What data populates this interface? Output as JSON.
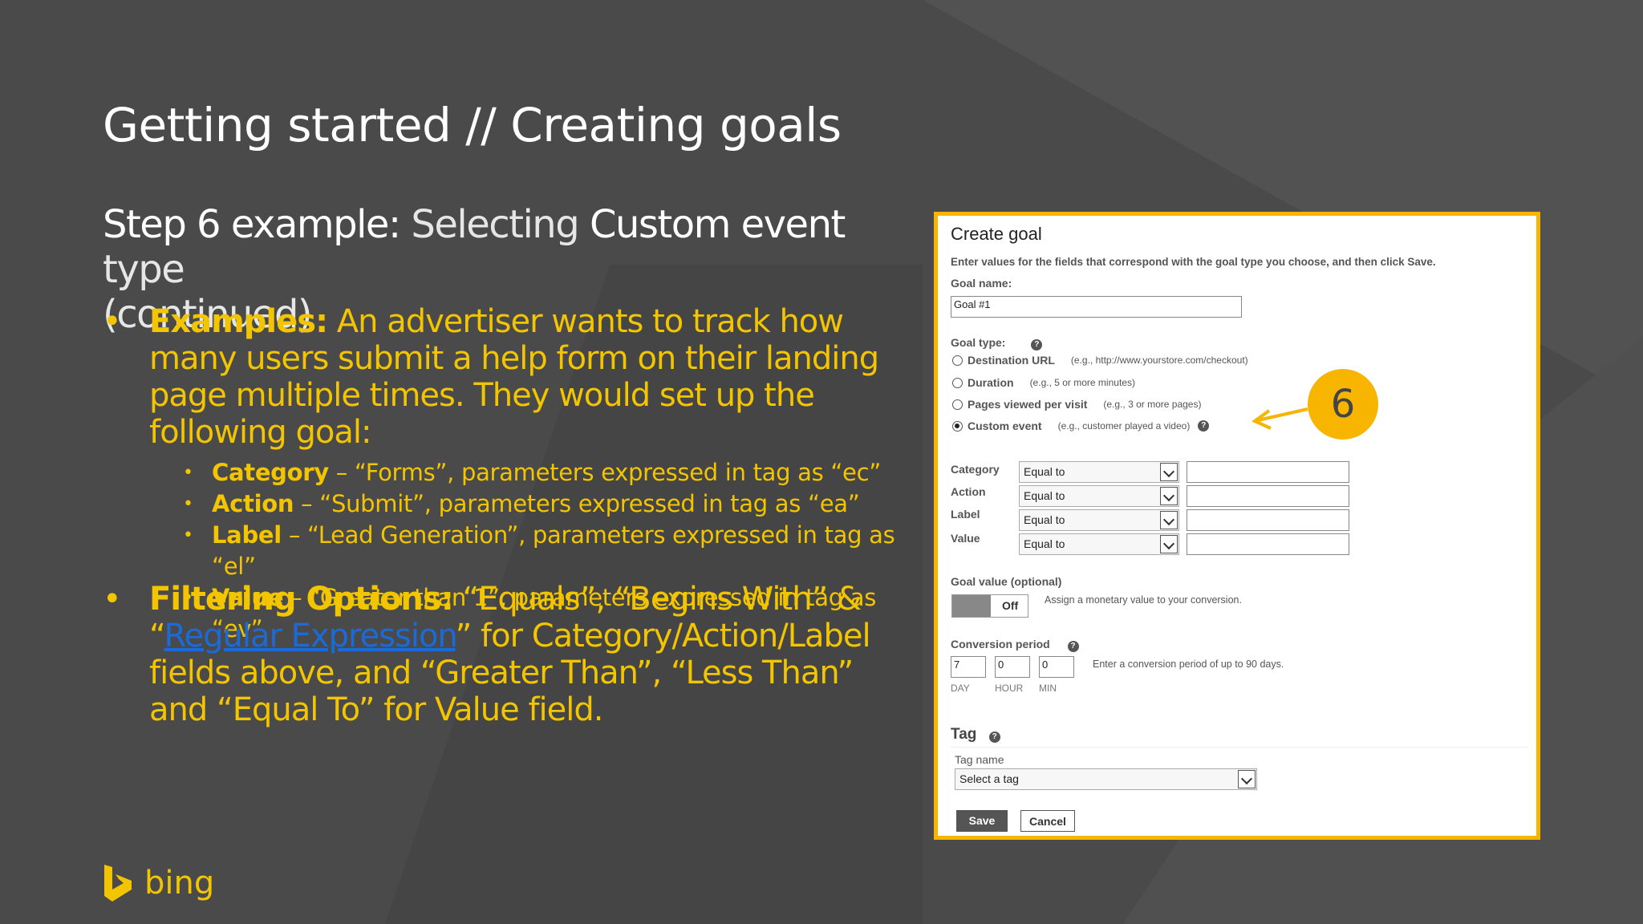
{
  "slide": {
    "title": "Getting started // Creating goals",
    "subtitle_bold1": "Step 6 example:",
    "subtitle_light1": " Selecting ",
    "subtitle_bold2": "Custom event",
    "subtitle_light2": " type",
    "subtitle_line2": "(continued)",
    "bullet_char": "•",
    "examples": {
      "label": "Examples:",
      "text": " An advertiser wants to track how many users submit a help form on their landing page multiple times. They would set up the following goal:"
    },
    "sub_items": [
      {
        "label": "Category",
        "text": " – “Forms”, parameters expressed in tag as “ec”"
      },
      {
        "label": "Action",
        "text": " – “Submit”, parameters expressed in tag as “ea”"
      },
      {
        "label": "Label",
        "text": " – “Lead Generation”, parameters expressed in tag as “el”"
      },
      {
        "label": "Value",
        "text": " – “Greater than 1”, parameters expressed in tag as “ev”"
      }
    ],
    "filtering": {
      "label": "Filtering Options:",
      "text_a": " “Equals”, “Begins With” & “",
      "link": "Regular Expression",
      "text_b": "” for Category/Action/Label fields above, and “Greater Than”, “Less Than” and “Equal To” for Value field."
    },
    "callout_number": "6",
    "brand": "bing"
  },
  "form": {
    "title": "Create goal",
    "description": "Enter values for the fields that correspond with the goal type you choose, and then click Save.",
    "goal_name_label": "Goal name:",
    "goal_name_value": "Goal #1",
    "goal_type_label": "Goal type:",
    "help_glyph": "?",
    "goal_types": [
      {
        "label": "Destination URL",
        "example": "(e.g., http://www.yourstore.com/checkout)",
        "checked": false
      },
      {
        "label": "Duration",
        "example": "(e.g., 5 or more minutes)",
        "checked": false
      },
      {
        "label": "Pages viewed per visit",
        "example": "(e.g., 3 or more pages)",
        "checked": false
      },
      {
        "label": "Custom event",
        "example": "(e.g., customer played a video)",
        "checked": true
      }
    ],
    "conditions": [
      {
        "label": "Category",
        "operator": "Equal to"
      },
      {
        "label": "Action",
        "operator": "Equal to"
      },
      {
        "label": "Label",
        "operator": "Equal to"
      },
      {
        "label": "Value",
        "operator": "Equal to"
      }
    ],
    "goal_value_label": "Goal value (optional)",
    "goal_value_toggle": "Off",
    "goal_value_note": "Assign a monetary value to your conversion.",
    "conversion_period_label": "Conversion period",
    "conversion_day": "7",
    "conversion_hour": "0",
    "conversion_min": "0",
    "unit_day": "DAY",
    "unit_hour": "HOUR",
    "unit_min": "MIN",
    "conversion_note": "Enter a conversion period of up to 90 days.",
    "tag_label": "Tag",
    "tag_name_label": "Tag name",
    "tag_select": "Select a tag",
    "save_label": "Save",
    "cancel_label": "Cancel"
  },
  "colors": {
    "background": "#4a4a4a",
    "accent": "#f2c500",
    "panel_border": "#f7b500",
    "link": "#1a6ad8"
  }
}
